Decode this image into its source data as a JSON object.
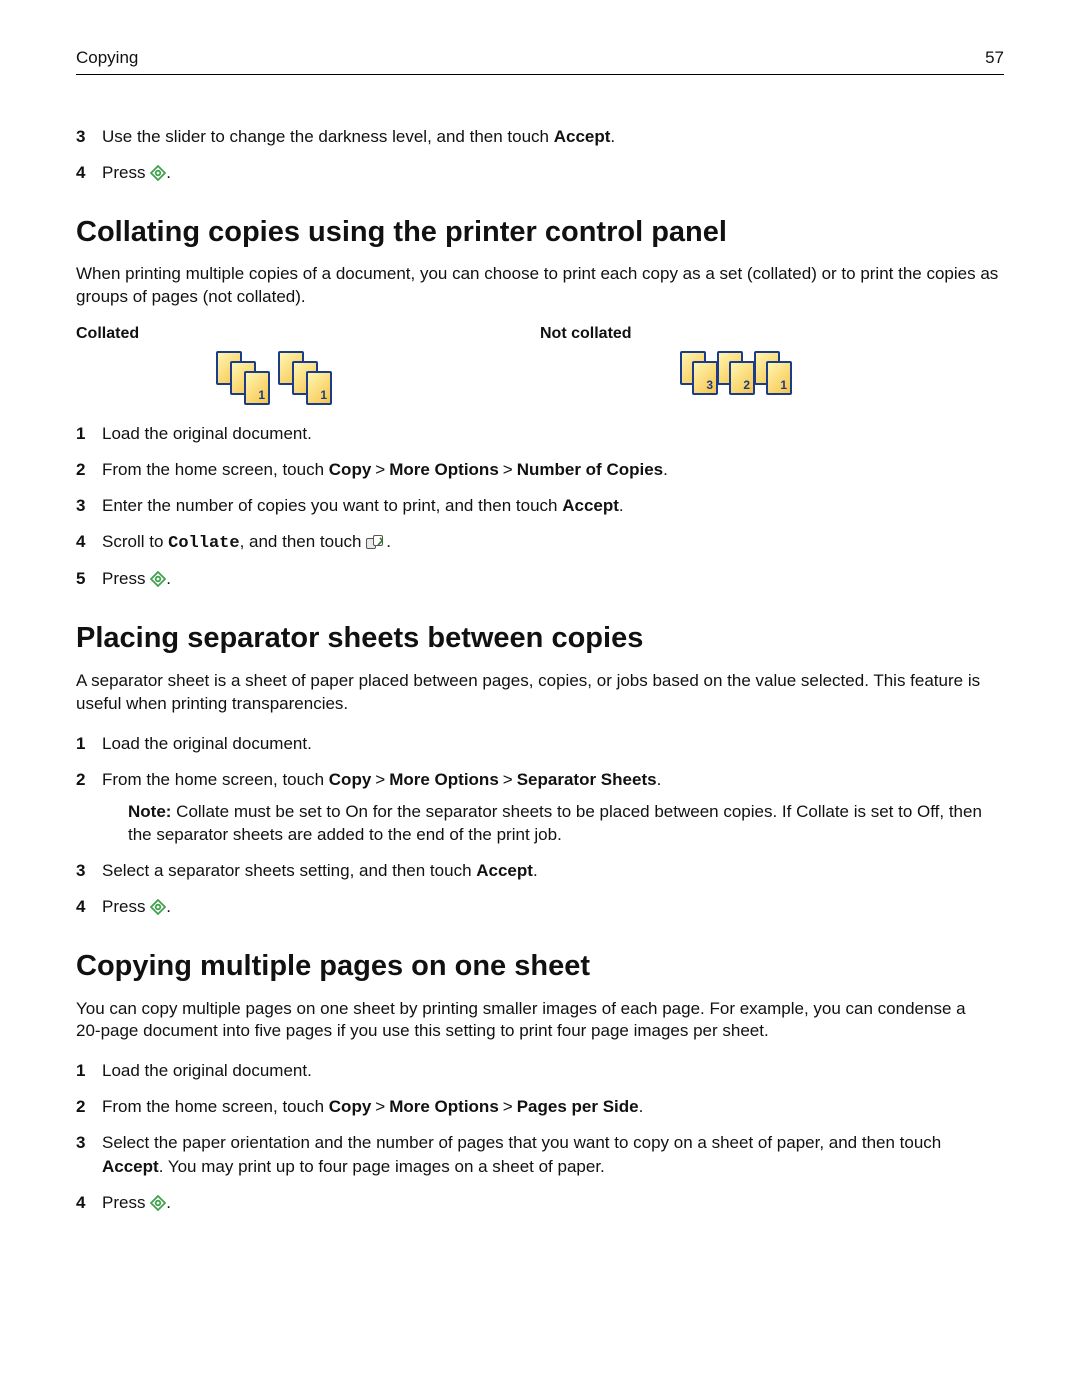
{
  "header": {
    "section": "Copying",
    "page_number": "57"
  },
  "intro_steps": [
    {
      "num": "3",
      "pre": "Use the slider to change the darkness level, and then touch ",
      "bold": "Accept",
      "post": "."
    },
    {
      "num": "4",
      "pre": "Press ",
      "icon": "start",
      "post": "."
    }
  ],
  "section_collate": {
    "title": "Collating copies using the printer control panel",
    "para": "When printing multiple copies of a document, you can choose to print each copy as a set (collated) or to print the copies as groups of pages (not collated).",
    "col_label_a": "Collated",
    "col_label_b": "Not collated",
    "steps": [
      {
        "num": "1",
        "text": "Load the original document."
      },
      {
        "num": "2",
        "pre": "From the home screen, touch ",
        "path": [
          "Copy",
          "More Options",
          "Number of Copies"
        ],
        "post": "."
      },
      {
        "num": "3",
        "pre": "Enter the number of copies you want to print, and then touch ",
        "bold": "Accept",
        "post": "."
      },
      {
        "num": "4",
        "pre": "Scroll to ",
        "mono": "Collate",
        "mid": ", and then touch ",
        "icon": "toggle",
        "post": "."
      },
      {
        "num": "5",
        "pre": "Press ",
        "icon": "start",
        "post": "."
      }
    ]
  },
  "section_sep": {
    "title": "Placing separator sheets between copies",
    "para": "A separator sheet is a sheet of paper placed between pages, copies, or jobs based on the value selected. This feature is useful when printing transparencies.",
    "steps": [
      {
        "num": "1",
        "text": "Load the original document."
      },
      {
        "num": "2",
        "pre": "From the home screen, touch ",
        "path": [
          "Copy",
          "More Options",
          "Separator Sheets"
        ],
        "post": ".",
        "note_label": "Note:",
        "note_text": " Collate must be set to On for the separator sheets to be placed between copies. If Collate is set to Off, then the separator sheets are added to the end of the print job."
      },
      {
        "num": "3",
        "pre": "Select a separator sheets setting, and then touch ",
        "bold": "Accept",
        "post": "."
      },
      {
        "num": "4",
        "pre": "Press ",
        "icon": "start",
        "post": "."
      }
    ]
  },
  "section_nup": {
    "title": "Copying multiple pages on one sheet",
    "para": "You can copy multiple pages on one sheet by printing smaller images of each page. For example, you can condense a 20‑page document into five pages if you use this setting to print four page images per sheet.",
    "steps": [
      {
        "num": "1",
        "text": "Load the original document."
      },
      {
        "num": "2",
        "pre": "From the home screen, touch ",
        "path": [
          "Copy",
          "More Options",
          "Pages per Side"
        ],
        "post": "."
      },
      {
        "num": "3",
        "pre": "Select the paper orientation and the number of pages that you want to copy on a sheet of paper, and then touch ",
        "bold": "Accept",
        "post": ". You may print up to four page images on a sheet of paper."
      },
      {
        "num": "4",
        "pre": "Press ",
        "icon": "start",
        "post": "."
      }
    ]
  },
  "labels": {
    "sep_gt": ">"
  }
}
